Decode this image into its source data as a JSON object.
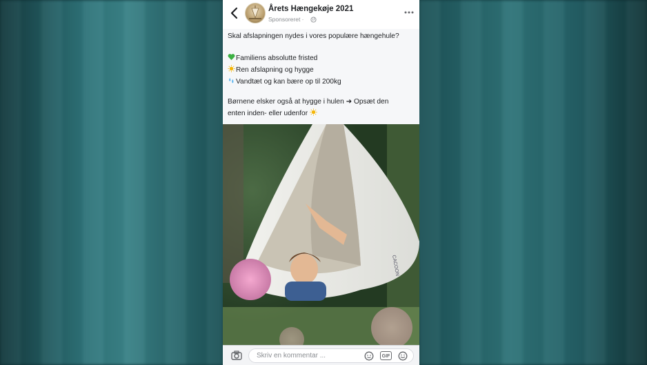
{
  "post": {
    "page_name": "Årets Hængekøje 2021",
    "sponsored_label": "Sponsoreret · ",
    "intro": "Skal afslapningen nydes i vores populære hængehule?",
    "bullets": [
      {
        "icon": "green-heart-icon",
        "text": "Familiens absolutte fristed"
      },
      {
        "icon": "sun-icon",
        "text": "Ren afslapning og hygge"
      },
      {
        "icon": "water-drops-icon",
        "text": "Vandtæt og kan bære op til 200kg"
      }
    ],
    "closing_line1": "Børnene elsker også at hygge i hulen ➜ Opsæt den",
    "closing_line2": "enten inden- eller udenfor "
  },
  "photo": {
    "description_icon": "hanging-tent-photo",
    "brand_tag": "CACOON"
  },
  "comment_bar": {
    "placeholder": "Skriv en kommentar ...",
    "gif_label": "GIF"
  },
  "colors": {
    "background_teal": "#2d7177",
    "text": "#1c1e21",
    "secondary_text": "#8a8d91"
  }
}
